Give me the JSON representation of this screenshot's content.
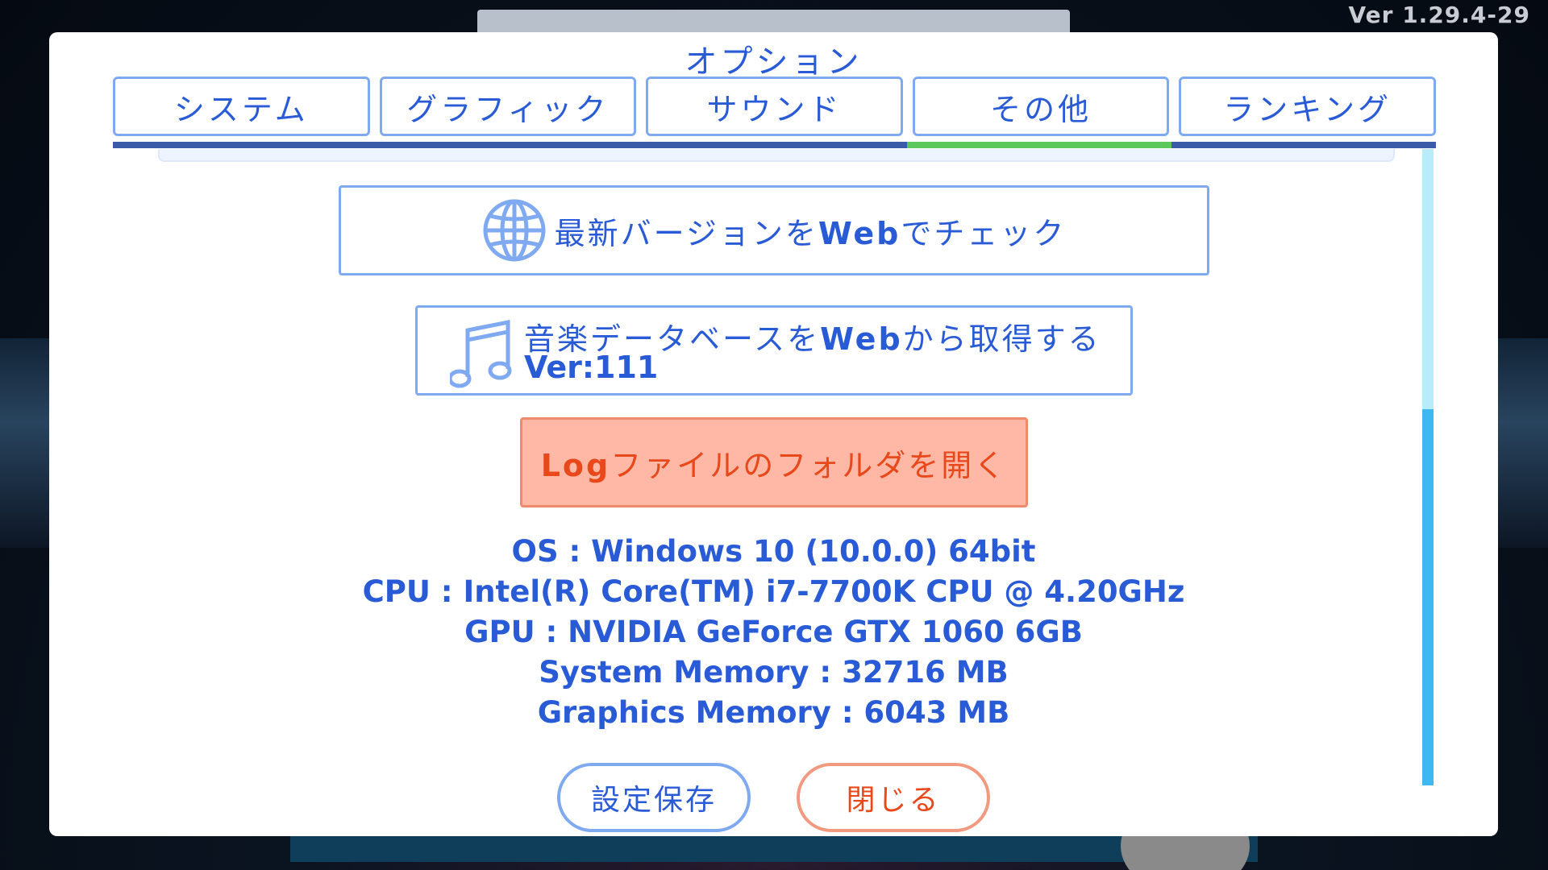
{
  "app": {
    "version": "Ver 1.29.4-29"
  },
  "dialog": {
    "title": "オプション",
    "tabs": [
      {
        "label": "システム",
        "active": false
      },
      {
        "label": "グラフィック",
        "active": false
      },
      {
        "label": "サウンド",
        "active": false
      },
      {
        "label": "その他",
        "active": true
      },
      {
        "label": "ランキング",
        "active": false
      }
    ],
    "check_version": {
      "prefix": "最新バージョンを",
      "bold": "Web",
      "suffix": "でチェック",
      "icon": "globe-icon"
    },
    "music_db": {
      "prefix": "音楽データベースを",
      "bold": "Web",
      "suffix": "から取得する",
      "version": "Ver:111",
      "icon": "music-note-icon"
    },
    "log_folder": {
      "bold": "Log",
      "suffix": "ファイルのフォルダを開く"
    },
    "system_info": {
      "os": "OS : Windows 10  (10.0.0) 64bit",
      "cpu": "CPU : Intel(R) Core(TM) i7-7700K CPU @ 4.20GHz",
      "gpu": "GPU : NVIDIA GeForce GTX 1060 6GB",
      "system_memory": "System Memory : 32716 MB",
      "graphics_memory": "Graphics Memory : 6043 MB"
    },
    "buttons": {
      "save": "設定保存",
      "close": "閉じる"
    }
  },
  "colors": {
    "accent_blue": "#2a5bd7",
    "border_blue": "#7fa9f0",
    "active_tab_indicator": "#5cc85c",
    "danger_text": "#e8481a",
    "danger_fill": "#ffb8a6",
    "scroll_thumb": "#3fb8f2"
  }
}
